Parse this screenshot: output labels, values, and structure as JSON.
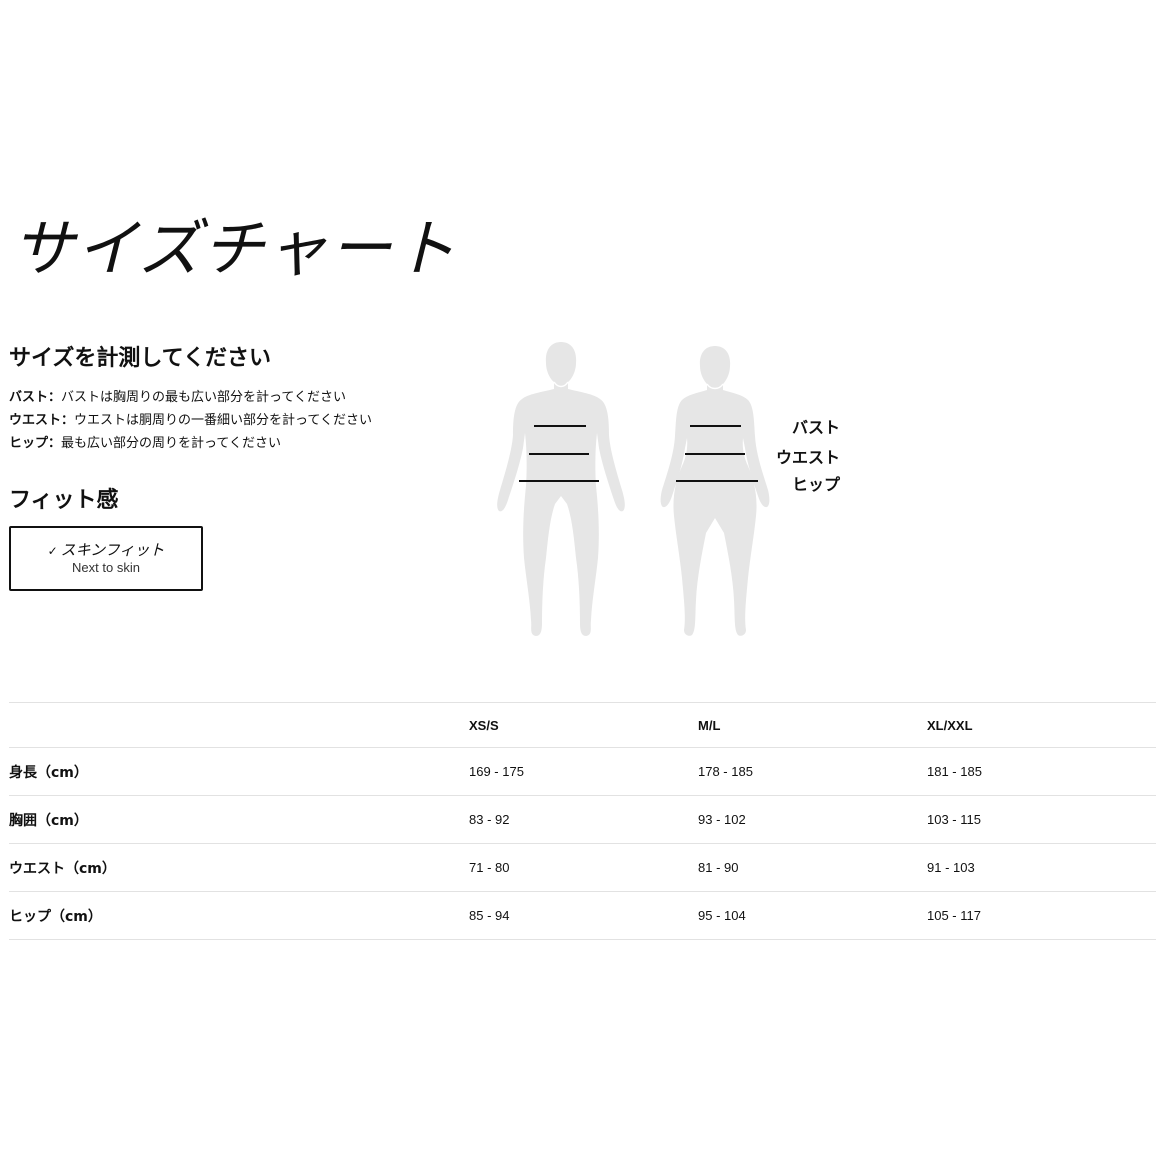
{
  "title": "サイズチャート",
  "measure": {
    "heading": "サイズを計測してください",
    "items": [
      {
        "term": "バスト：",
        "desc": "バストは胸周りの最も広い部分を計ってください"
      },
      {
        "term": "ウエスト：",
        "desc": "ウエストは胴周りの一番細い部分を計ってください"
      },
      {
        "term": "ヒップ：",
        "desc": "最も広い部分の周りを計ってください"
      }
    ]
  },
  "fit": {
    "heading": "フィット感",
    "option_label": "スキンフィット",
    "option_sub": "Next to skin",
    "check_icon": "✓"
  },
  "figure_labels": {
    "bust": "バスト",
    "waist": "ウエスト",
    "hip": "ヒップ"
  },
  "colors": {
    "silhouette": "#e6e6e6",
    "measure_line": "#111111",
    "divider": "#e2e2e2"
  },
  "table": {
    "columns": [
      "",
      "XS/S",
      "M/L",
      "XL/XXL"
    ],
    "rows": [
      {
        "label": "身長（cm）",
        "values": [
          "169 - 175",
          "178 - 185",
          "181 - 185"
        ]
      },
      {
        "label": "胸囲（cm）",
        "values": [
          "83 - 92",
          "93 - 102",
          "103 - 115"
        ]
      },
      {
        "label": "ウエスト（cm）",
        "values": [
          "71 - 80",
          "81 - 90",
          "91 - 103"
        ]
      },
      {
        "label": "ヒップ（cm）",
        "values": [
          "85 - 94",
          "95 - 104",
          "105 - 117"
        ]
      }
    ]
  }
}
